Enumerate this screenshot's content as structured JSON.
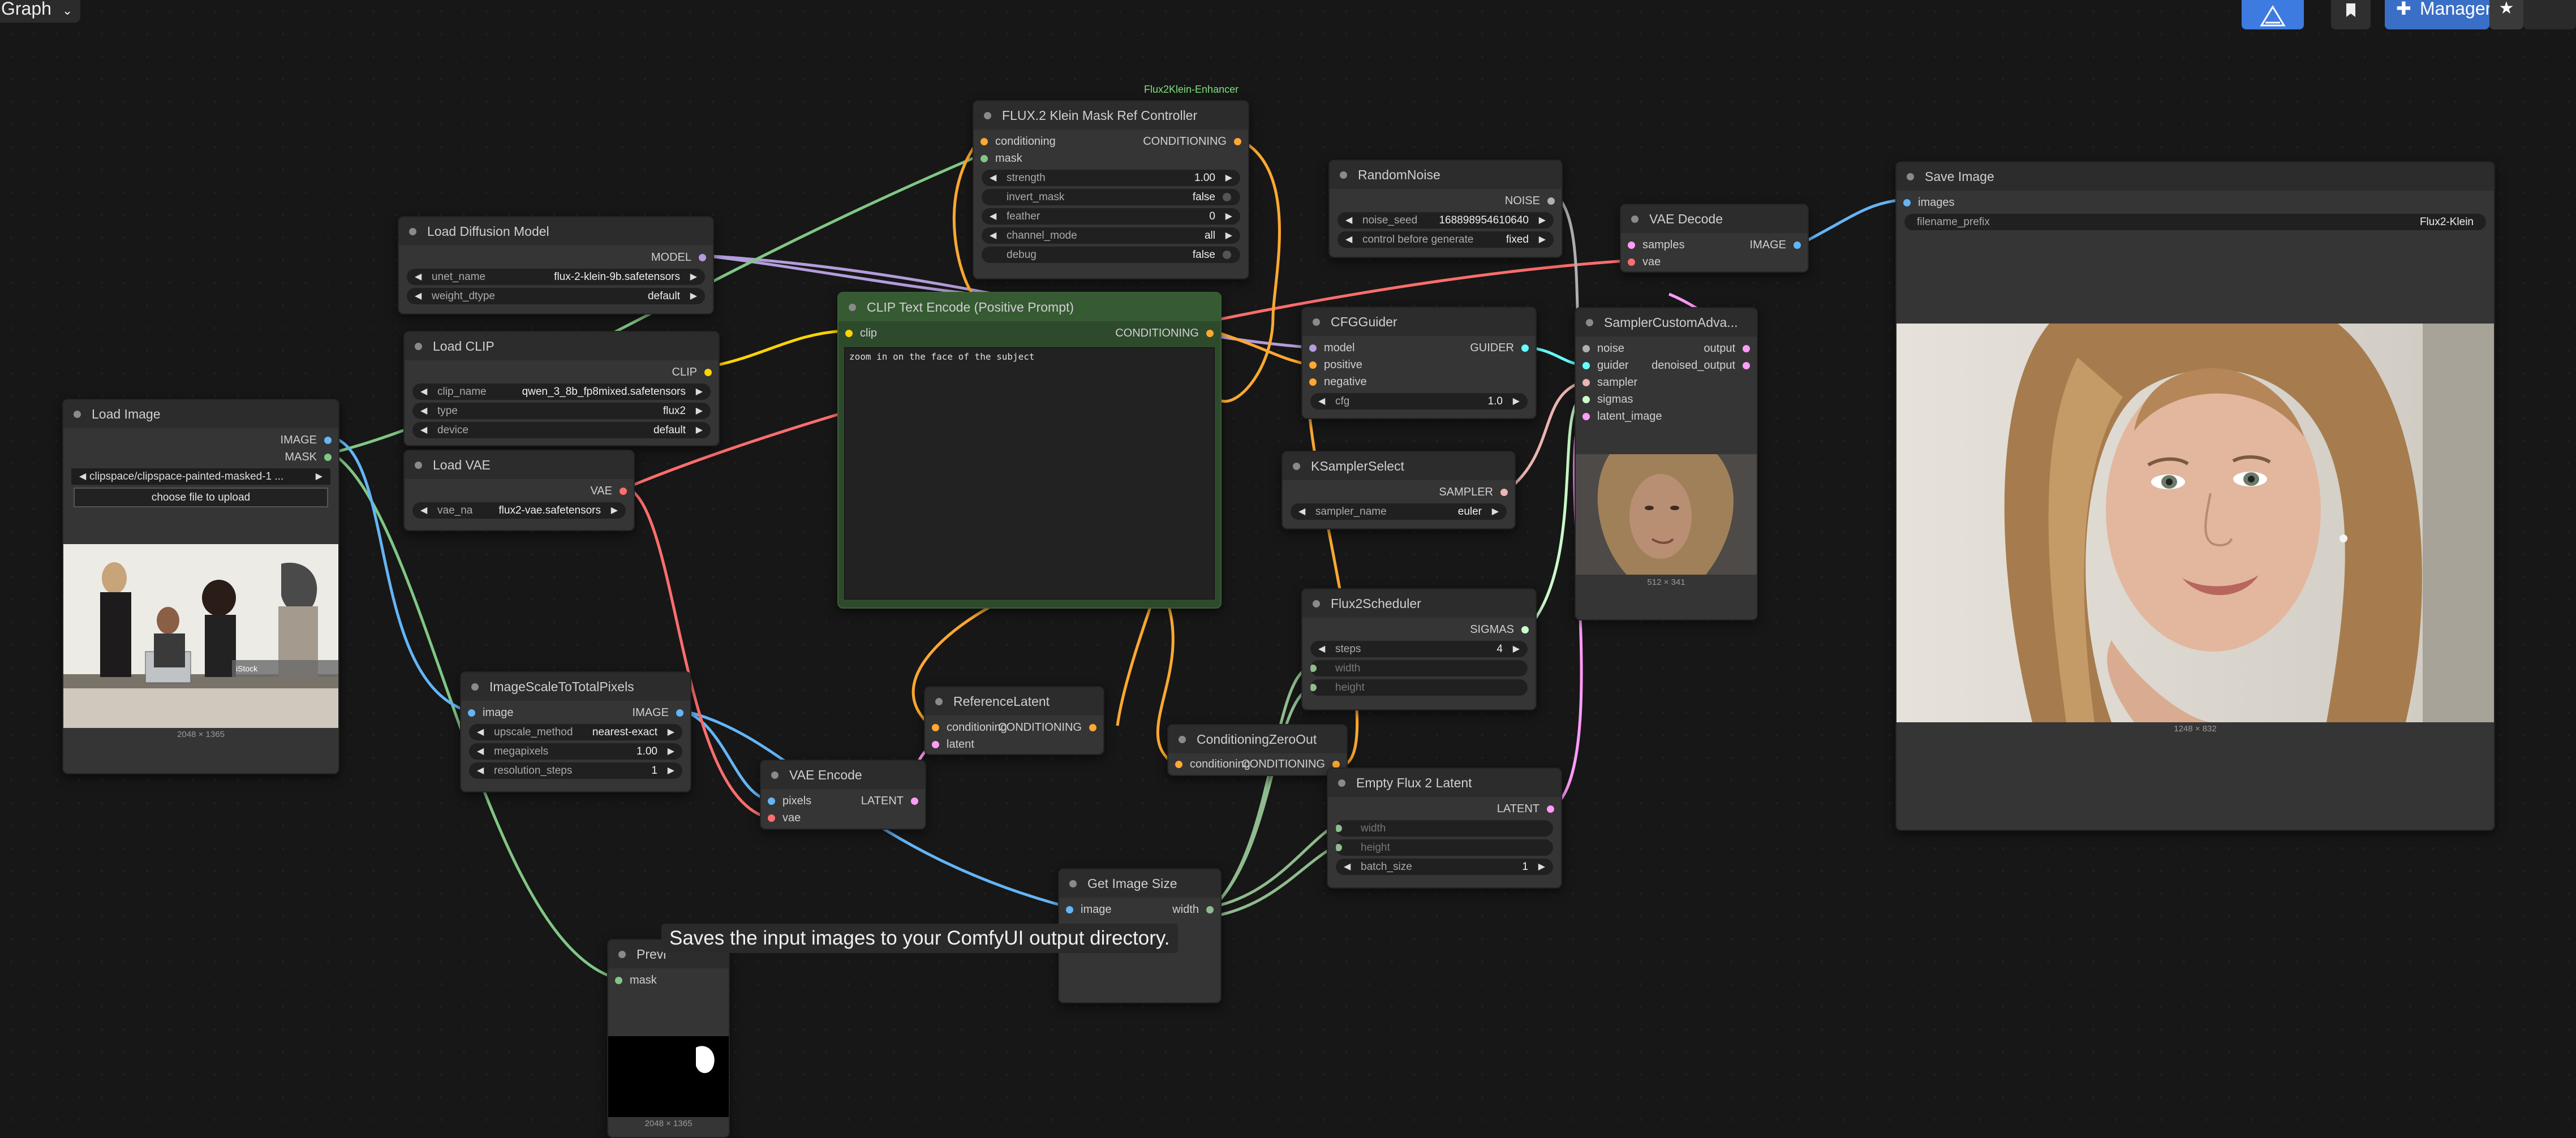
{
  "topbar": {
    "graph_label": "Graph",
    "graph_chevron": "chevron-down-icon",
    "manager_label": "Manager",
    "manager_icon": "puzzle-icon",
    "bookmark_icon": "bookmark-icon",
    "star_icon": "star-icon",
    "accent": "#3d7be0"
  },
  "group": {
    "label": "Flux2Klein-Enhancer"
  },
  "tooltip": {
    "text": "Saves the input images to your ComfyUI output directory."
  },
  "colors": {
    "model": "#b39ddb",
    "clip": "#ffd500",
    "vae": "#ff6e6e",
    "conditioning": "#ffa931",
    "image": "#64b5f6",
    "mask": "#81c784",
    "latent": "#ff9cf9",
    "noise": "#b0b0b0",
    "guider": "#66ffff",
    "sampler": "#ecb4b4",
    "sigmas": "#cdffcd",
    "int": "#8fbc8f"
  },
  "nodes": {
    "load_image": {
      "title": "Load Image",
      "out_image": "IMAGE",
      "out_mask": "MASK",
      "image_value": "clipspace/clipspace-painted-masked-1 ...",
      "upload_label": "choose file to upload",
      "caption": "2048 × 1365"
    },
    "load_diffusion_model": {
      "title": "Load Diffusion Model",
      "out_model": "MODEL",
      "unet_label": "unet_name",
      "unet_value": "flux-2-klein-9b.safetensors",
      "dtype_label": "weight_dtype",
      "dtype_value": "default"
    },
    "load_clip": {
      "title": "Load CLIP",
      "out_clip": "CLIP",
      "clip_label": "clip_name",
      "clip_value": "qwen_3_8b_fp8mixed.safetensors",
      "type_label": "type",
      "type_value": "flux2",
      "device_label": "device",
      "device_value": "default"
    },
    "load_vae": {
      "title": "Load VAE",
      "out_vae": "VAE",
      "vae_label": "vae_na",
      "vae_value": "flux2-vae.safetensors"
    },
    "image_scale": {
      "title": "ImageScaleToTotalPixels",
      "in_image": "image",
      "out_image": "IMAGE",
      "upscale_label": "upscale_method",
      "upscale_value": "nearest-exact",
      "mp_label": "megapixels",
      "mp_value": "1.00",
      "steps_label": "resolution_steps",
      "steps_value": "1"
    },
    "preview": {
      "title": "Previ",
      "in_mask": "mask",
      "caption": "2048 × 1365"
    },
    "vae_encode": {
      "title": "VAE Encode",
      "in_pixels": "pixels",
      "in_vae": "vae",
      "out_latent": "LATENT"
    },
    "flux_mask": {
      "title": "FLUX.2 Klein Mask Ref Controller",
      "in_cond": "conditioning",
      "in_mask": "mask",
      "out_cond": "CONDITIONING",
      "strength_label": "strength",
      "strength_value": "1.00",
      "invert_label": "invert_mask",
      "invert_value": "false",
      "feather_label": "feather",
      "feather_value": "0",
      "channel_label": "channel_mode",
      "channel_value": "all",
      "debug_label": "debug",
      "debug_value": "false"
    },
    "clip_text": {
      "title": "CLIP Text Encode (Positive Prompt)",
      "in_clip": "clip",
      "out_cond": "CONDITIONING",
      "prompt": "zoom in on the face of the subject"
    },
    "ref_latent": {
      "title": "ReferenceLatent",
      "in_cond": "conditioning",
      "in_latent": "latent",
      "out_cond": "CONDITIONING"
    },
    "get_image_size": {
      "title": "Get Image Size",
      "in_image": "image",
      "out_width": "width"
    },
    "cond_zero": {
      "title": "ConditioningZeroOut",
      "in_cond": "conditioning",
      "out_cond": "CONDITIONING"
    },
    "random_noise": {
      "title": "RandomNoise",
      "out_noise": "NOISE",
      "seed_label": "noise_seed",
      "seed_value": "168898954610640",
      "control_label": "control before generate",
      "control_value": "fixed"
    },
    "cfg_guider": {
      "title": "CFGGuider",
      "in_model": "model",
      "in_pos": "positive",
      "in_neg": "negative",
      "out_guider": "GUIDER",
      "cfg_label": "cfg",
      "cfg_value": "1.0"
    },
    "ksampler_select": {
      "title": "KSamplerSelect",
      "out_sampler": "SAMPLER",
      "sampler_label": "sampler_name",
      "sampler_value": "euler"
    },
    "flux2_scheduler": {
      "title": "Flux2Scheduler",
      "out_sigmas": "SIGMAS",
      "steps_label": "steps",
      "steps_value": "4",
      "width_label": "width",
      "height_label": "height"
    },
    "empty_latent": {
      "title": "Empty Flux 2 Latent",
      "out_latent": "LATENT",
      "width_label": "width",
      "height_label": "height",
      "batch_label": "batch_size",
      "batch_value": "1"
    },
    "vae_decode": {
      "title": "VAE Decode",
      "in_samples": "samples",
      "in_vae": "vae",
      "out_image": "IMAGE"
    },
    "sampler_custom": {
      "title": "SamplerCustomAdva...",
      "in_noise": "noise",
      "in_guider": "guider",
      "in_sampler": "sampler",
      "in_sigmas": "sigmas",
      "in_latent": "latent_image",
      "out_output": "output",
      "out_denoised": "denoised_output",
      "caption": "512 × 341"
    },
    "save_image": {
      "title": "Save Image",
      "in_images": "images",
      "prefix_label": "filename_prefix",
      "prefix_value": "Flux2-Klein",
      "caption": "1248 × 832"
    }
  }
}
